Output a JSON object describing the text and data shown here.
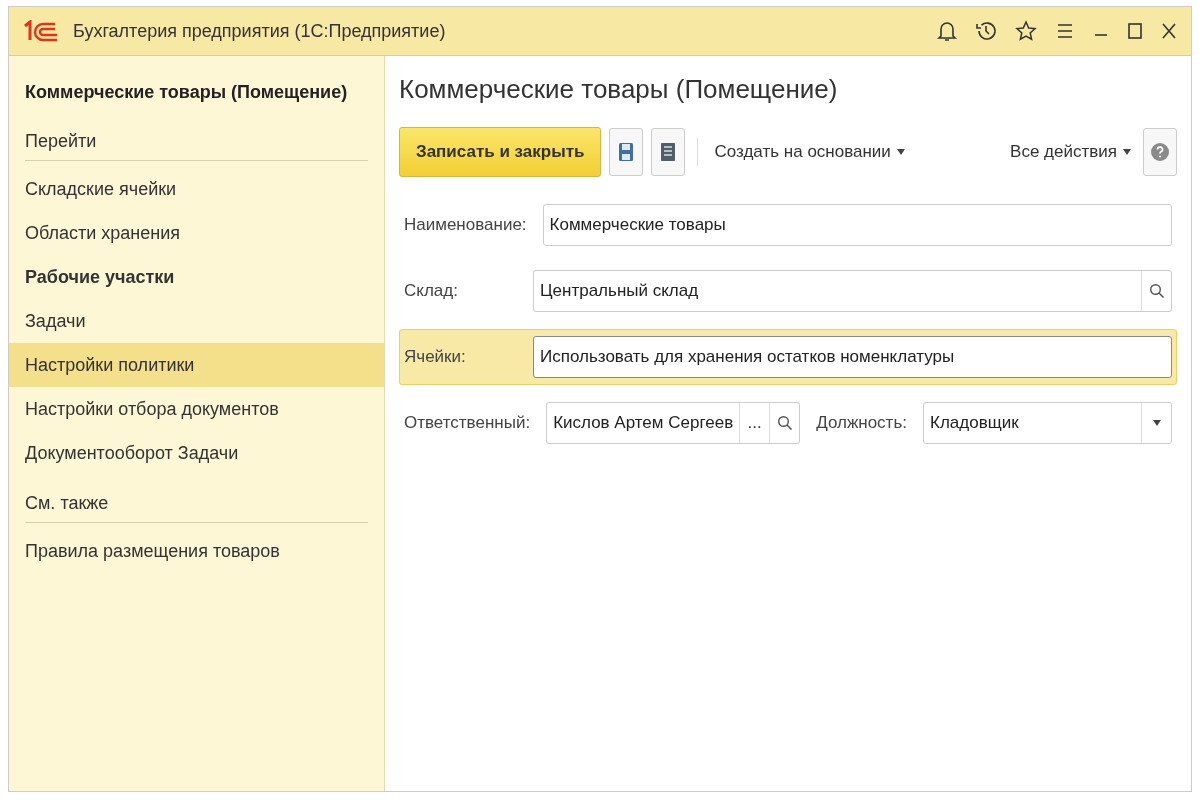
{
  "window": {
    "title": "Бухгалтерия предприятия (1С:Предприятие)"
  },
  "sidebar": {
    "title": "Коммерческие товары (Помещение)",
    "groups": [
      {
        "heading": "Перейти",
        "items": [
          {
            "label": "Складские ячейки",
            "selected": false,
            "bold": false
          },
          {
            "label": "Области хранения",
            "selected": false,
            "bold": false
          },
          {
            "label": "Рабочие участки",
            "selected": false,
            "bold": true
          },
          {
            "label": "Задачи",
            "selected": false,
            "bold": false
          },
          {
            "label": "Настройки политики",
            "selected": true,
            "bold": false
          },
          {
            "label": "Настройки отбора документов",
            "selected": false,
            "bold": false
          },
          {
            "label": "Документооборот Задачи",
            "selected": false,
            "bold": false
          }
        ]
      },
      {
        "heading": "См. также",
        "items": [
          {
            "label": "Правила размещения товаров",
            "selected": false,
            "bold": false
          }
        ]
      }
    ]
  },
  "form": {
    "title": "Коммерческие товары (Помещение)",
    "toolbar": {
      "primary_button": "Записать и закрыть",
      "create_based_on": "Создать на основании",
      "all_actions": "Все действия"
    },
    "rows": [
      {
        "focused": false,
        "fields": [
          {
            "kind": "text",
            "label": "Наименование:",
            "value": "Коммерческие товары"
          }
        ]
      },
      {
        "focused": false,
        "fields": [
          {
            "kind": "lookup",
            "label": "Склад:",
            "value": "Центральный склад"
          }
        ]
      },
      {
        "focused": true,
        "fields": [
          {
            "kind": "text",
            "label": "Ячейки:",
            "value": "Использовать для хранения остатков номенклатуры"
          }
        ]
      },
      {
        "focused": false,
        "fields": [
          {
            "kind": "choice",
            "label": "Ответственный:",
            "value": "Кислов Артем Сергеев",
            "choice_button": "..."
          },
          {
            "kind": "dropdown",
            "label": "Должность:",
            "value": "Кладовщик"
          }
        ]
      }
    ]
  }
}
